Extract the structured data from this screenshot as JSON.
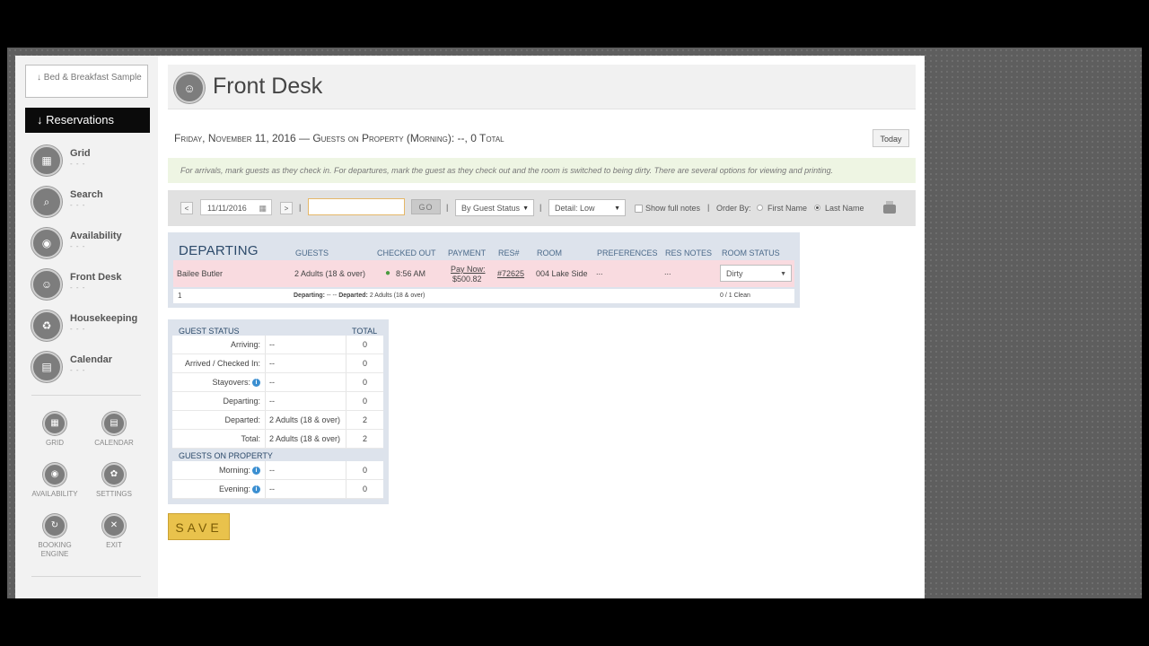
{
  "sidebar": {
    "property": "↓ Bed & Breakfast Sample",
    "reservations": "↓ Reservations",
    "nav": [
      {
        "label": "Grid",
        "sub": "- - -"
      },
      {
        "label": "Search",
        "sub": "- - -"
      },
      {
        "label": "Availability",
        "sub": "- - -"
      },
      {
        "label": "Front Desk",
        "sub": "- - -"
      },
      {
        "label": "Housekeeping",
        "sub": "- - -"
      },
      {
        "label": "Calendar",
        "sub": "- - -"
      }
    ],
    "quick": [
      {
        "label": "GRID"
      },
      {
        "label": "CALENDAR"
      },
      {
        "label": "AVAILABILITY"
      },
      {
        "label": "SETTINGS"
      },
      {
        "label": "BOOKING ENGINE"
      },
      {
        "label": "EXIT"
      }
    ]
  },
  "header": {
    "title": "Front Desk",
    "dateline": "Friday, November 11, 2016 — Guests on Property (Morning): --, 0 Total",
    "today_label": "Today"
  },
  "hint": "For arrivals, mark guests as they check in. For departures, mark the guest as they check out and the room is switched to being dirty. There are several options for viewing and printing.",
  "toolbar": {
    "prev": "<",
    "date": "11/11/2016",
    "next": ">",
    "sep": "|",
    "search_value": "",
    "go": "GO",
    "status_filter": "By Guest Status",
    "detail_filter": "Detail: Low",
    "show_full_notes": "Show full notes",
    "order_by": "Order By:",
    "first_name": "First Name",
    "last_name": "Last Name"
  },
  "departing": {
    "title": "DEPARTING",
    "headers": [
      "GUESTS",
      "CHECKED OUT",
      "PAYMENT",
      "RES#",
      "ROOM",
      "PREFERENCES",
      "RES NOTES",
      "ROOM STATUS"
    ],
    "row": {
      "name": "Bailee Butler",
      "guests": "2 Adults (18 & over)",
      "checked_out": "8:56 AM",
      "payment_line1": "Pay Now:",
      "payment_line2": "$500.82",
      "res": "#72625",
      "room": "004 Lake Side",
      "preferences": "...",
      "res_notes": "...",
      "room_status": "Dirty"
    },
    "footer": {
      "count": "1",
      "departing_label": "Departing:",
      "departing_value": "-- --",
      "departed_label": "Departed:",
      "departed_value": "2 Adults (18 & over)",
      "clean": "0 / 1 Clean"
    }
  },
  "guest_status": {
    "title": "GUEST STATUS",
    "total_header": "TOTAL",
    "rows": [
      {
        "label": "Arriving:",
        "value": "--",
        "total": "0"
      },
      {
        "label": "Arrived / Checked In:",
        "value": "--",
        "total": "0"
      },
      {
        "label": "Stayovers:",
        "value": "--",
        "total": "0"
      },
      {
        "label": "Departing:",
        "value": "--",
        "total": "0"
      },
      {
        "label": "Departed:",
        "value": "2 Adults (18 & over)",
        "total": "2"
      },
      {
        "label": "Total:",
        "value": "2 Adults (18 & over)",
        "total": "2"
      }
    ],
    "on_property_title": "GUESTS ON PROPERTY",
    "on_property": [
      {
        "label": "Morning:",
        "value": "--",
        "total": "0"
      },
      {
        "label": "Evening:",
        "value": "--",
        "total": "0"
      }
    ]
  },
  "save_label": "SAVE"
}
